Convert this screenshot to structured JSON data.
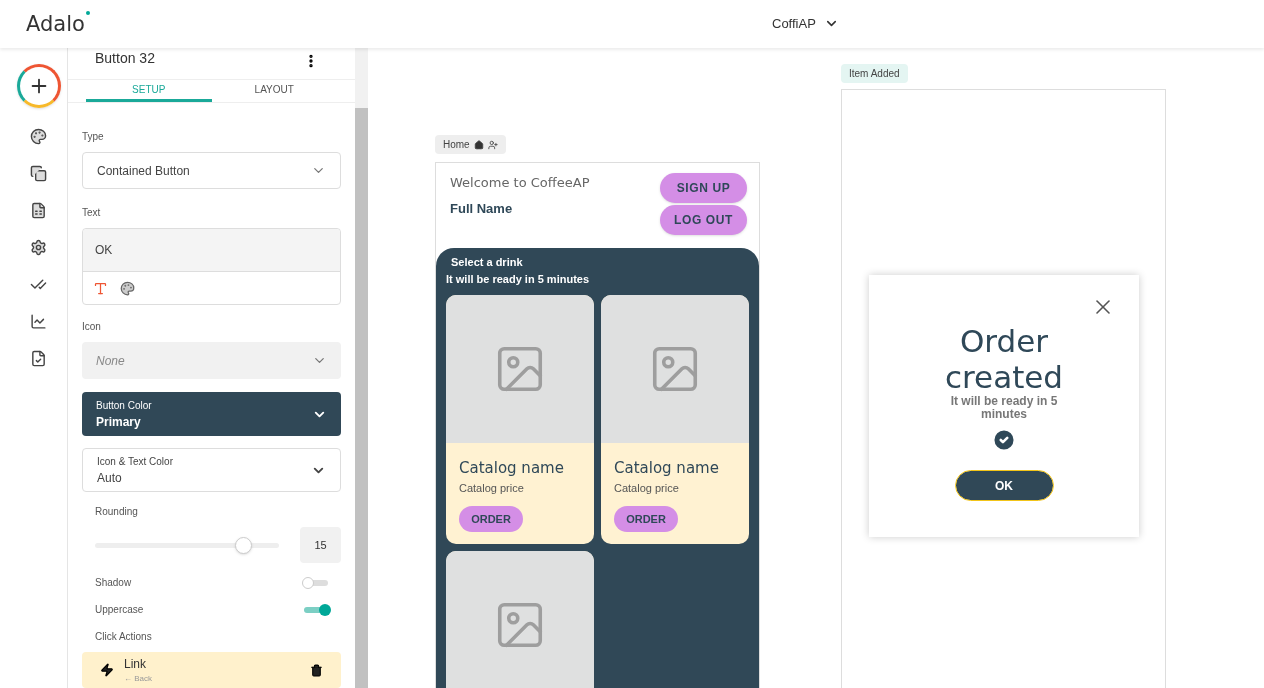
{
  "app": {
    "logo": "Adalo",
    "project": "CoffiAP"
  },
  "panel": {
    "component_name": "Button 32",
    "tabs": [
      {
        "label": "SETUP",
        "selected": true
      },
      {
        "label": "LAYOUT",
        "selected": false
      }
    ],
    "type": {
      "label": "Type",
      "value": "Contained Button"
    },
    "text": {
      "label": "Text",
      "value": "OK"
    },
    "icon": {
      "label": "Icon",
      "placeholder": "None"
    },
    "button_color": {
      "label": "Button Color",
      "value": "Primary"
    },
    "icon_text_color": {
      "label": "Icon & Text Color",
      "value": "Auto"
    },
    "rounding": {
      "label": "Rounding",
      "level": 0.84,
      "value": "15"
    },
    "toggles": [
      {
        "label": "Shadow",
        "on": false
      },
      {
        "label": "Uppercase",
        "on": true
      }
    ],
    "click_actions": {
      "label": "Click Actions",
      "items": [
        {
          "title": "Link",
          "subtitle": "← Back"
        }
      ]
    }
  },
  "screens": [
    {
      "kind": "home",
      "name": "Home",
      "welcome": "Welcome to CoffeeAP",
      "full_name": "Full Name",
      "buttons": [
        "SIGN UP",
        "LOG OUT"
      ],
      "section_title": "Select a drink",
      "section_subtitle": "It will be ready in 5 minutes",
      "cards": [
        {
          "kind": "product",
          "name": "Catalog name",
          "price": "Catalog price",
          "button": "ORDER"
        },
        {
          "kind": "product",
          "name": "Catalog name",
          "price": "Catalog price",
          "button": "ORDER"
        },
        {
          "kind": "image_only"
        }
      ]
    },
    {
      "kind": "modal",
      "name": "Item Added",
      "title": "Order created",
      "message": "It will be ready in 5 minutes",
      "button": {
        "label": "OK",
        "selected": true
      }
    }
  ]
}
